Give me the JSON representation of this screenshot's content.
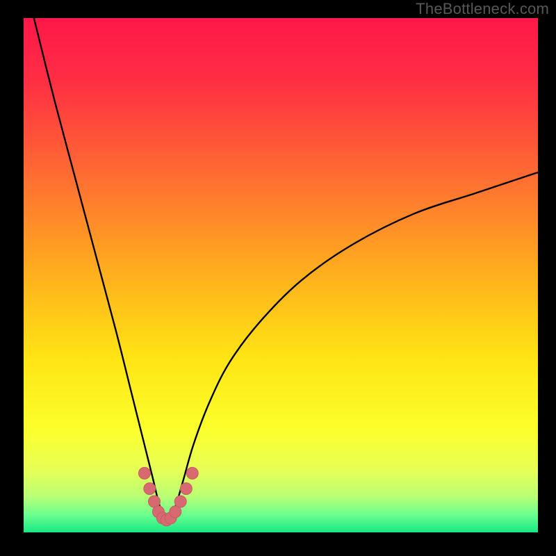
{
  "watermark": "TheBottleneck.com",
  "colors": {
    "frame": "#000000",
    "gradient_stops": [
      {
        "offset": 0.0,
        "color": "#ff1849"
      },
      {
        "offset": 0.12,
        "color": "#ff2e44"
      },
      {
        "offset": 0.3,
        "color": "#ff6a33"
      },
      {
        "offset": 0.5,
        "color": "#ffb01d"
      },
      {
        "offset": 0.66,
        "color": "#ffe414"
      },
      {
        "offset": 0.8,
        "color": "#fcff2c"
      },
      {
        "offset": 0.88,
        "color": "#e6ff57"
      },
      {
        "offset": 0.93,
        "color": "#b9ff75"
      },
      {
        "offset": 0.965,
        "color": "#6cff8f"
      },
      {
        "offset": 1.0,
        "color": "#17e884"
      }
    ],
    "curve": "#000000",
    "marker_fill": "#d76a70",
    "marker_stroke": "#c95a61"
  },
  "chart_data": {
    "type": "line",
    "title": "",
    "xlabel": "",
    "ylabel": "",
    "xlim": [
      0,
      100
    ],
    "ylim": [
      0,
      100
    ],
    "grid": false,
    "legend": false,
    "notes": "V-shaped bottleneck curve. x roughly corresponds to a component balance parameter (0–100); y corresponds to bottleneck severity (0 = no bottleneck, 100 = full bottleneck). Minimum around x≈28. Left branch is steep, right branch rises gently toward ~70 at x=100. Values estimated from pixels.",
    "series": [
      {
        "name": "bottleneck-curve",
        "x": [
          2,
          6,
          10,
          14,
          18,
          21,
          23,
          25,
          26.5,
          28,
          29.5,
          31,
          33,
          36,
          40,
          46,
          54,
          64,
          76,
          88,
          100
        ],
        "y": [
          100,
          84,
          69,
          54,
          39,
          27,
          19,
          11,
          5,
          2,
          5,
          10,
          17,
          25,
          33,
          41,
          49,
          56,
          62,
          66,
          70
        ]
      }
    ],
    "markers": {
      "name": "highlighted-minimum",
      "x": [
        23.5,
        24.5,
        25.4,
        26.2,
        27,
        27.8,
        28.6,
        29.5,
        30.5,
        31.6,
        32.8
      ],
      "y": [
        11.5,
        8.5,
        6,
        4,
        2.8,
        2.4,
        2.8,
        4,
        6,
        8.5,
        11.5
      ]
    }
  }
}
